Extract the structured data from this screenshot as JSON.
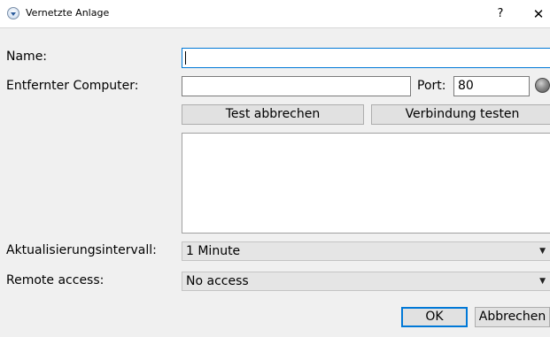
{
  "window": {
    "title": "Vernetzte Anlage",
    "help_symbol": "?",
    "close_symbol": "✕",
    "icon": "app-globe-icon"
  },
  "form": {
    "name_label": "Name:",
    "name_value": "",
    "remote_label": "Entfernter Computer:",
    "remote_value": "",
    "port_label": "Port:",
    "port_value": "80",
    "status_icon": "connection-status-indicator",
    "cancel_test_label": "Test abbrechen",
    "test_connection_label": "Verbindung testen",
    "output_text": "",
    "interval_label": "Aktualisierungsintervall:",
    "interval_value": "1 Minute",
    "remote_access_label": "Remote access:",
    "remote_access_value": "No access",
    "dropdown_arrow": "▼"
  },
  "footer": {
    "ok_label": "OK",
    "cancel_label": "Abbrechen"
  },
  "colors": {
    "focus_border": "#0078d7",
    "window_bg": "#f0f0f0",
    "button_bg": "#e1e1e1"
  }
}
